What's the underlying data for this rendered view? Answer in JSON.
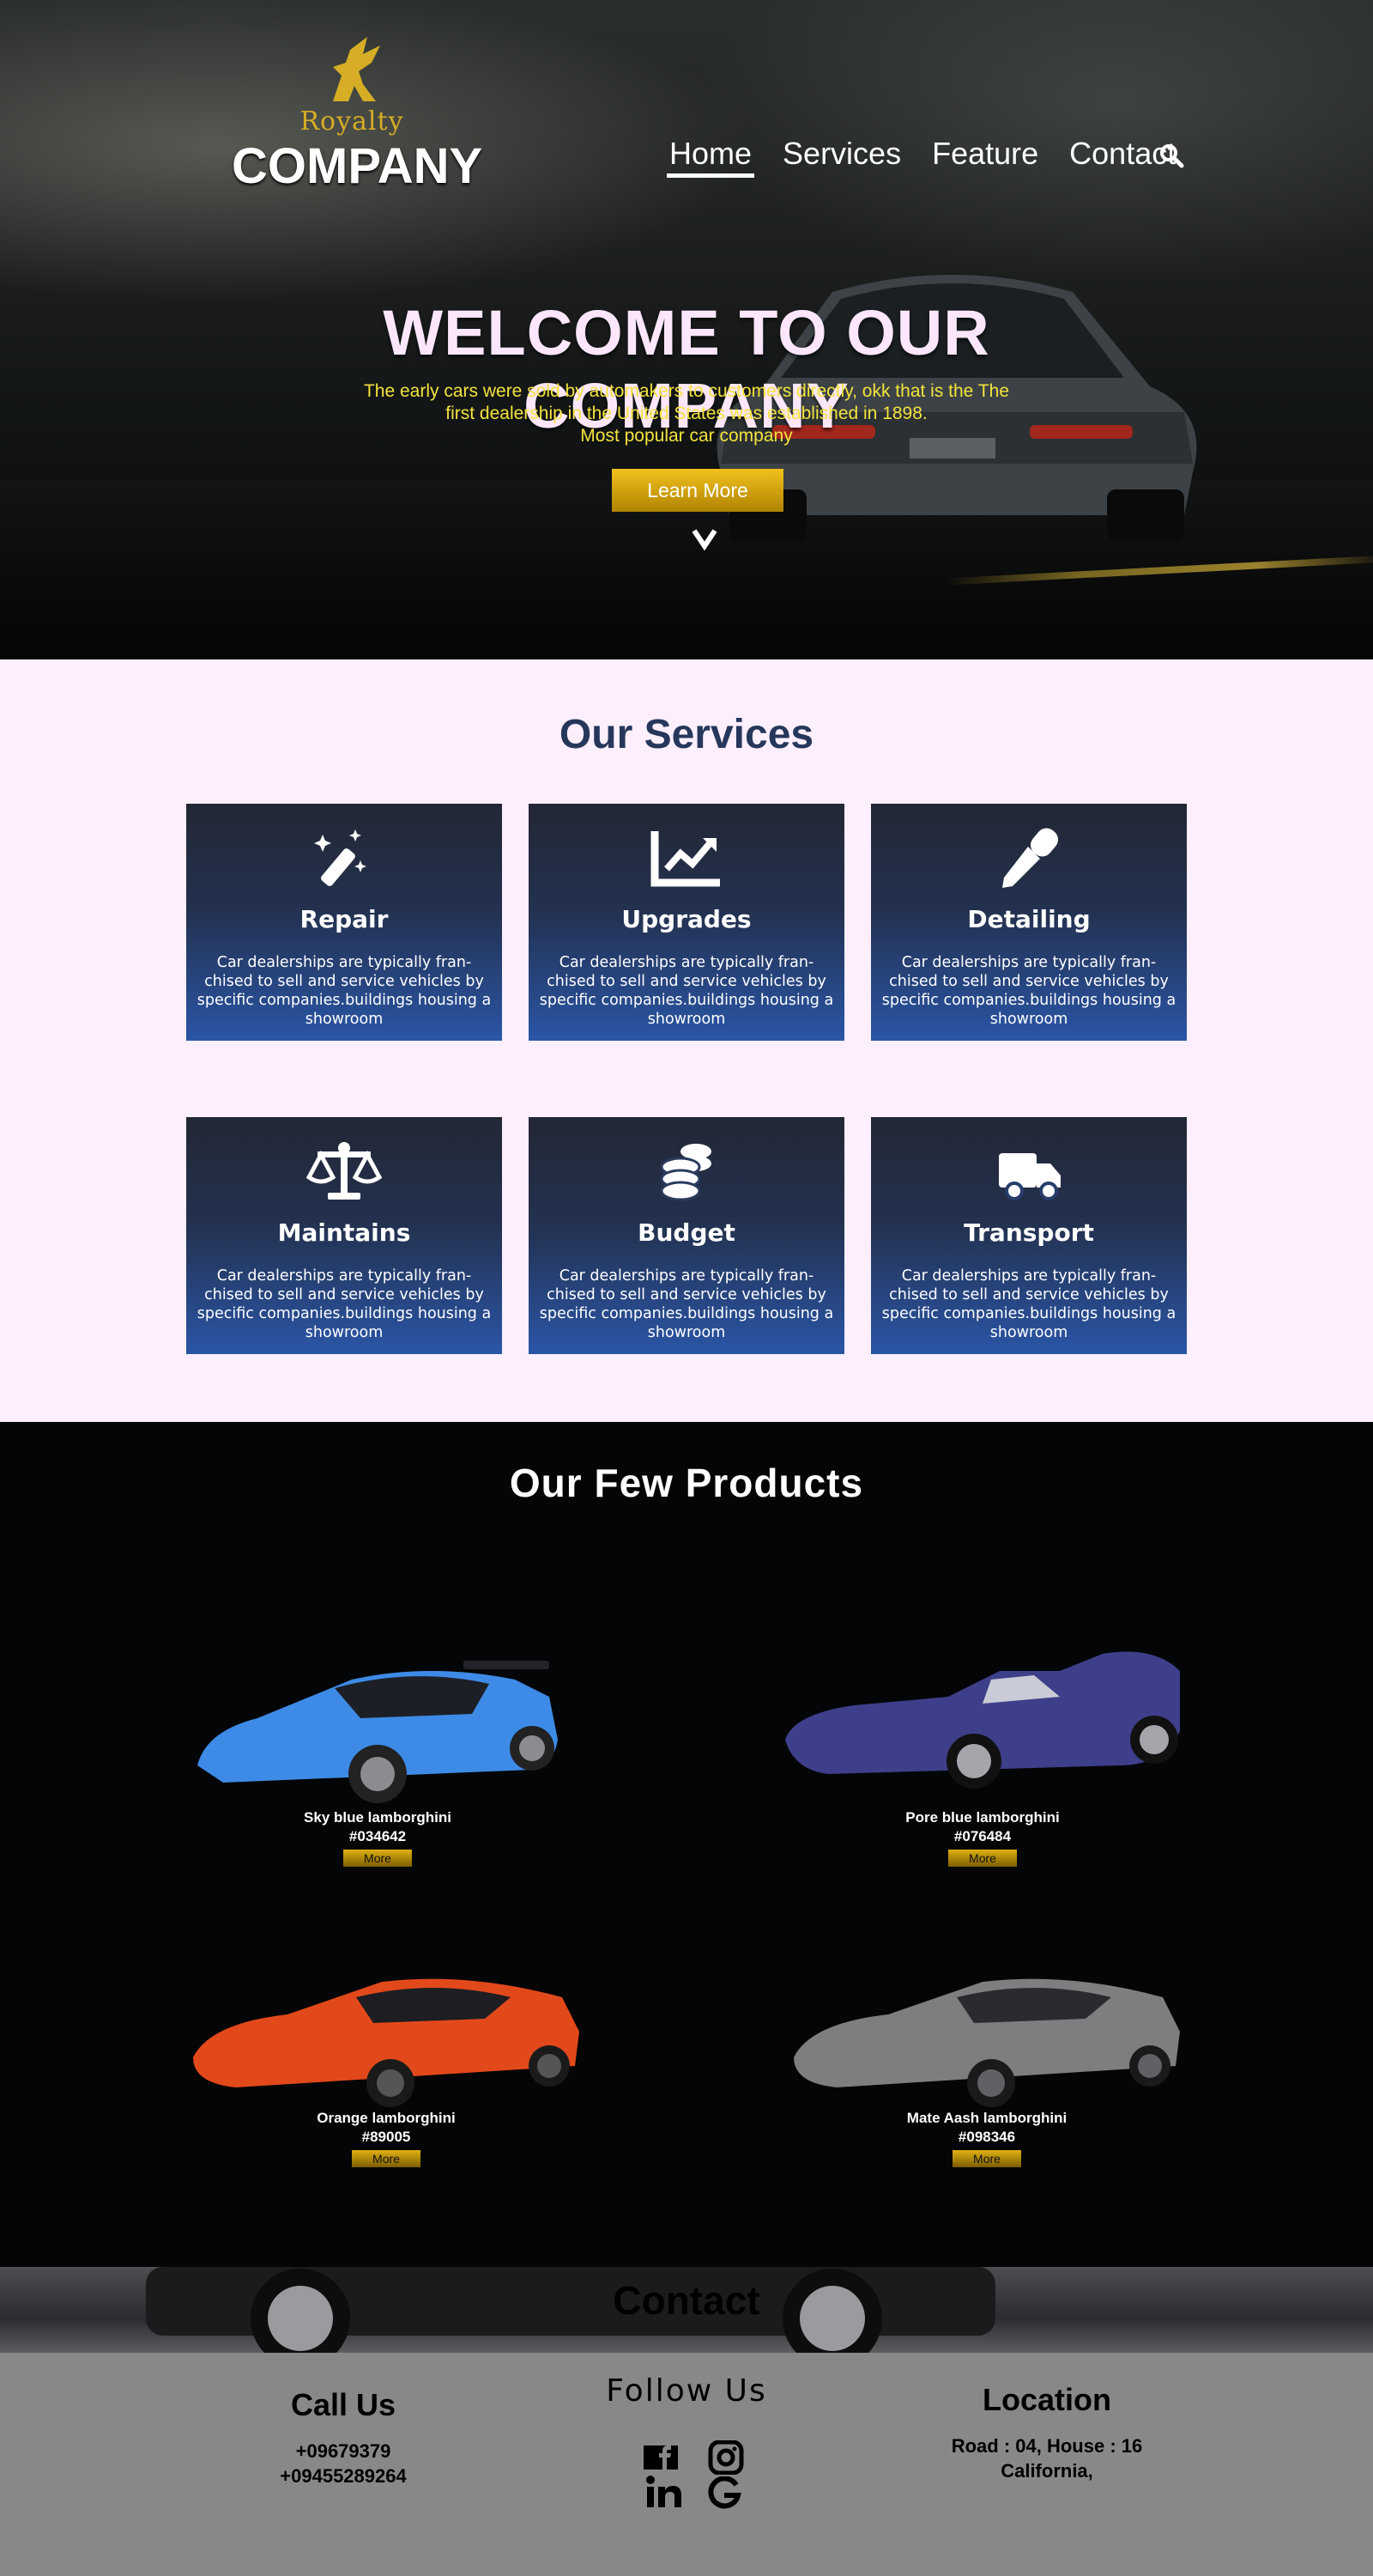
{
  "header": {
    "logo_text": "Royalty",
    "company": "COMPANY",
    "nav": [
      "Home",
      "Services",
      "Feature",
      "Contact"
    ]
  },
  "hero": {
    "title": "WELCOME TO OUR COMPANY",
    "subtitle_lines": [
      "The early cars were sold by automakers to customers directly, okk that is the The",
      "first dealership in the United States was established in 1898.",
      "Most popular car company"
    ],
    "button": "Learn More"
  },
  "services": {
    "title": "Our Services",
    "items": [
      {
        "title": "Repair",
        "icon": "magic-wand-icon",
        "text": "Car dealerships are typically fran-chised to sell and service vehicles by specific companies.buildings housing a showroom"
      },
      {
        "title": "Upgrades",
        "icon": "chart-line-icon",
        "text": "Car dealerships are typically fran-chised to sell and service vehicles by specific companies.buildings housing a showroom"
      },
      {
        "title": "Detailing",
        "icon": "eyedropper-icon",
        "text": "Car dealerships are typically fran-chised to sell and service vehicles by specific companies.buildings housing a showroom"
      },
      {
        "title": "Maintains",
        "icon": "balance-scale-icon",
        "text": "Car dealerships are typically fran-chised to sell and service vehicles by specific companies.buildings housing a showroom"
      },
      {
        "title": "Budget",
        "icon": "coins-icon",
        "text": "Car dealerships are typically fran-chised to sell and service vehicles by specific companies.buildings housing a showroom"
      },
      {
        "title": "Transport",
        "icon": "truck-icon",
        "text": "Car dealerships are typically fran-chised to sell and service vehicles by specific companies.buildings housing a showroom"
      }
    ]
  },
  "products": {
    "title": "Our Few Products",
    "items": [
      {
        "name": "Sky blue lamborghini",
        "code": "#034642",
        "button": "More",
        "color": "#3d8be6"
      },
      {
        "name": "Pore blue lamborghini",
        "code": "#076484",
        "button": "More",
        "color": "#3e3f8a"
      },
      {
        "name": "Orange  lamborghini",
        "code": "#89005",
        "button": "More",
        "color": "#e2491a"
      },
      {
        "name": "Mate Aash lamborghini",
        "code": "#098346",
        "button": "More",
        "color": "#7d7e80"
      }
    ]
  },
  "contact": {
    "title": "Contact",
    "call": {
      "heading": "Call Us",
      "phones": [
        "+09679379",
        "+09455289264"
      ]
    },
    "follow": {
      "heading": "Follow Us",
      "icons": [
        "facebook-icon",
        "instagram-icon",
        "linkedin-icon",
        "google-icon"
      ]
    },
    "location": {
      "heading": "Location",
      "lines": [
        "Road : 04, House : 16",
        "California,"
      ]
    }
  },
  "colors": {
    "accent_gold": "#d6ad25",
    "hero_subtitle": "#f3e33d",
    "services_bg": "#fdeffd",
    "services_title": "#26375c",
    "card_top": "#232735",
    "card_bottom": "#2a55a6",
    "products_bg": "#040506",
    "footer_bg": "#888888"
  }
}
